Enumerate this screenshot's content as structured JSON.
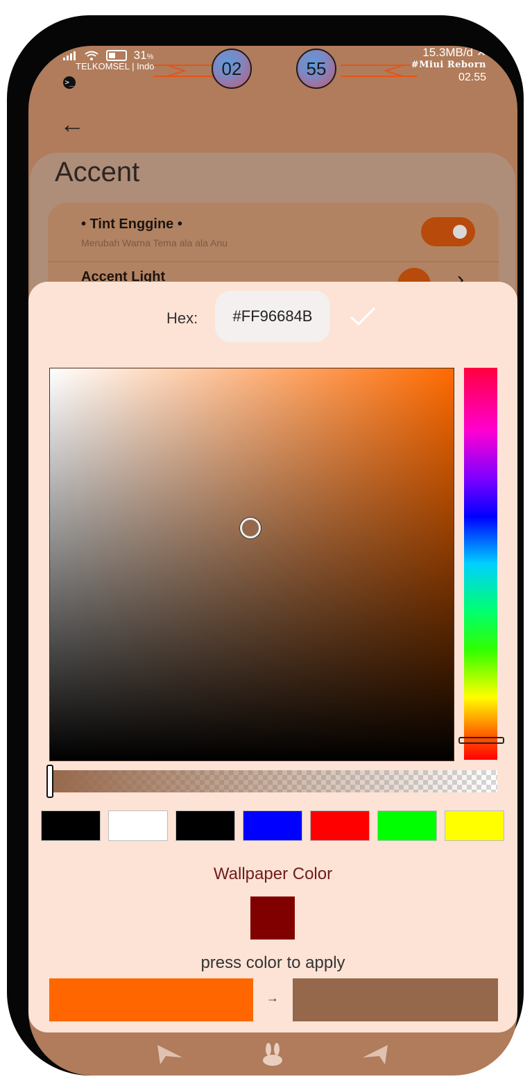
{
  "status_bar": {
    "battery_pct": "31",
    "battery_unit": "%",
    "carrier": "TELKOMSEL | Indo",
    "hour": "02",
    "minute": "55",
    "net_speed": "15.3MB/d",
    "brand": "#Miui Reborn",
    "time": "02.55"
  },
  "header": {
    "back_icon": "back-arrow-icon",
    "title": "Accent"
  },
  "preferences": [
    {
      "title": "• Tint Enggine •",
      "subtitle": "Merubah Warna Tema ala ala Anu",
      "toggle_on": true
    },
    {
      "title": "Accent Light"
    }
  ],
  "dialog": {
    "hex_label": "Hex:",
    "hex_value": "#FF96684B",
    "confirm_icon": "check-icon",
    "swatches": [
      "#000000",
      "#ffffff",
      "#000000",
      "#0000ff",
      "#ff0000",
      "#00ff00",
      "#ffff00"
    ],
    "wallpaper_label": "Wallpaper Color",
    "wallpaper_color": "#800000",
    "apply_label": "press color to apply",
    "old_color": "#ff6600",
    "arrow": "→",
    "new_color": "#96684b",
    "hue_level": 0.95,
    "alpha_level": 1.0
  },
  "nav": [
    "back-nav-icon",
    "home-rabbit-icon",
    "recents-nav-icon"
  ]
}
